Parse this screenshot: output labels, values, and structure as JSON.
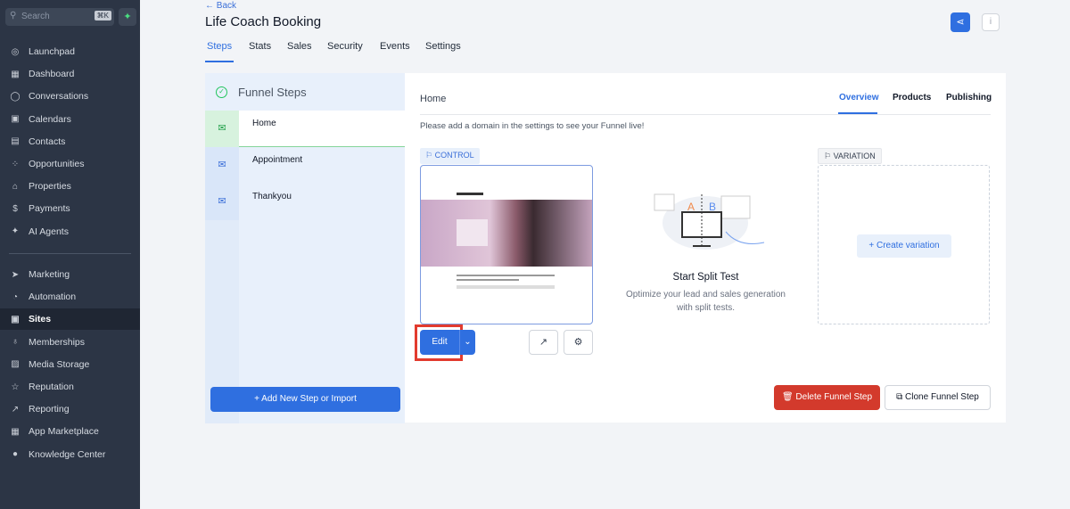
{
  "sidebar": {
    "search_placeholder": "Search",
    "shortcut": "⌘K",
    "items": [
      {
        "label": "Launchpad",
        "icon": "◎"
      },
      {
        "label": "Dashboard",
        "icon": "▦"
      },
      {
        "label": "Conversations",
        "icon": "◯"
      },
      {
        "label": "Calendars",
        "icon": "▣"
      },
      {
        "label": "Contacts",
        "icon": "▤"
      },
      {
        "label": "Opportunities",
        "icon": "⁘"
      },
      {
        "label": "Properties",
        "icon": "⌂"
      },
      {
        "label": "Payments",
        "icon": "$"
      },
      {
        "label": "AI Agents",
        "icon": "✦"
      }
    ],
    "items2": [
      {
        "label": "Marketing",
        "icon": "➤"
      },
      {
        "label": "Automation",
        "icon": "◔"
      },
      {
        "label": "Sites",
        "icon": "▣"
      },
      {
        "label": "Memberships",
        "icon": "♁"
      },
      {
        "label": "Media Storage",
        "icon": "▨"
      },
      {
        "label": "Reputation",
        "icon": "☆"
      },
      {
        "label": "Reporting",
        "icon": "↗"
      },
      {
        "label": "App Marketplace",
        "icon": "▦"
      },
      {
        "label": "Knowledge Center",
        "icon": "●"
      }
    ]
  },
  "header": {
    "back": "← Back",
    "title": "Life Coach Booking",
    "tabs": [
      "Steps",
      "Stats",
      "Sales",
      "Security",
      "Events",
      "Settings"
    ]
  },
  "left": {
    "title": "Funnel Steps",
    "steps": [
      "Home",
      "Appointment",
      "Thankyou"
    ],
    "add": "+   Add New Step or Import"
  },
  "card": {
    "title": "Home",
    "tabs": [
      "Overview",
      "Products",
      "Publishing"
    ],
    "notice": "Please add a domain in the settings to see your Funnel live!",
    "control": "CONTROL",
    "variation": "VARIATION",
    "edit": "Edit",
    "split_title": "Start Split Test",
    "split_desc1": "Optimize your lead and sales generation",
    "split_desc2": "with split tests.",
    "create_variation": "+   Create variation",
    "delete": "Delete Funnel Step",
    "clone": "Clone Funnel Step"
  },
  "colors": {
    "accent": "#2f6fe0",
    "danger": "#d33a2c",
    "sidebar": "#2c3545"
  }
}
